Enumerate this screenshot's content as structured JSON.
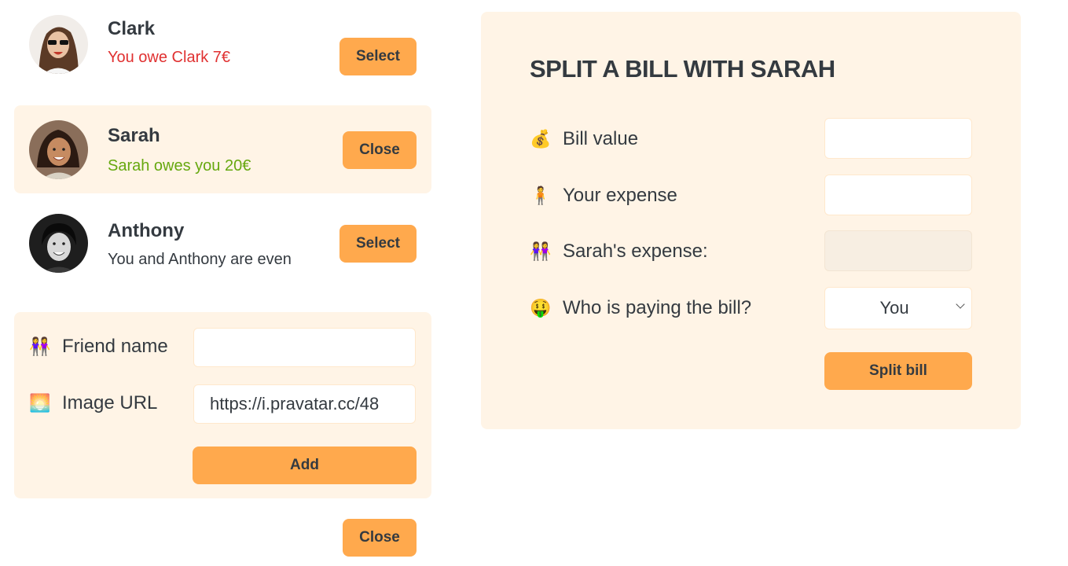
{
  "friends": [
    {
      "name": "Clark",
      "status": "You owe Clark 7€",
      "status_type": "owe",
      "button": "Select",
      "selected": false
    },
    {
      "name": "Sarah",
      "status": "Sarah owes you 20€",
      "status_type": "owed",
      "button": "Close",
      "selected": true
    },
    {
      "name": "Anthony",
      "status": "You and Anthony are even",
      "status_type": "even",
      "button": "Select",
      "selected": false
    }
  ],
  "add_friend": {
    "name_label": "Friend name",
    "name_value": "",
    "image_label": "Image URL",
    "image_value": "https://i.pravatar.cc/48",
    "add_button": "Add"
  },
  "close_button": "Close",
  "split": {
    "title": "SPLIT A BILL WITH SARAH",
    "bill_label": "Bill value",
    "bill_value": "",
    "your_label": "Your expense",
    "your_value": "",
    "friend_label": "Sarah's expense:",
    "friend_value": "",
    "payer_label": "Who is paying the bill?",
    "payer_value": "You",
    "submit": "Split bill"
  },
  "icons": {
    "bill": "money-bag-icon",
    "your": "person-icon",
    "friend": "two-people-icon",
    "payer": "money-mouth-face-icon",
    "friend_name": "two-people-icon",
    "image_url": "sunset-image-icon"
  },
  "colors": {
    "accent": "#ffa94d",
    "panel_bg": "#fff4e6",
    "red": "#e03131",
    "green": "#66a80f"
  }
}
